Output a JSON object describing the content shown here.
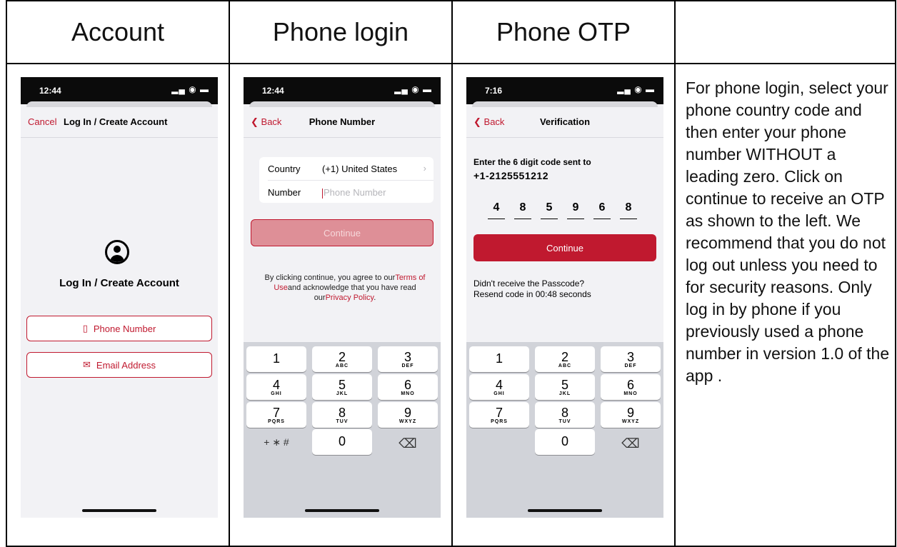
{
  "headers": [
    "Account",
    "Phone login",
    "Phone OTP",
    ""
  ],
  "phone_account": {
    "time": "12:44",
    "status_icons": "▂▄ ◉ ▬",
    "nav_left": "Cancel",
    "nav_title": "Log In / Create Account",
    "heading": "Log In / Create Account",
    "phone_button": "Phone Number",
    "email_button": "Email Address",
    "phone_glyph": "▯",
    "email_glyph": "✉"
  },
  "phone_login": {
    "time": "12:44",
    "status_icons": "▂▄ ◉ ▬",
    "back_glyph": "❮",
    "nav_left": "Back",
    "nav_title": "Phone Number",
    "country_label": "Country",
    "country_value": "(+1) United States",
    "chevron": "›",
    "number_label": "Number",
    "number_placeholder": "Phone Number",
    "continue_label": "Continue",
    "legal_pre": "By clicking continue, you agree to our",
    "legal_terms": "Terms of Use",
    "legal_mid": "and acknowledge that you have read our",
    "legal_privacy": "Privacy Policy",
    "legal_end": "."
  },
  "phone_otp": {
    "time": "7:16",
    "status_icons": "▂▄ ◉ ▬",
    "back_glyph": "❮",
    "nav_left": "Back",
    "nav_title": "Verification",
    "prompt": "Enter the 6 digit code sent to",
    "number": "+1-2125551212",
    "digits": [
      "4",
      "8",
      "5",
      "9",
      "6",
      "8"
    ],
    "continue_label": "Continue",
    "resend_line1": "Didn't receive the Passcode?",
    "resend_line2": "Resend code in 00:48 seconds"
  },
  "keypad": {
    "keys": [
      {
        "d": "1",
        "l": ""
      },
      {
        "d": "2",
        "l": "ABC"
      },
      {
        "d": "3",
        "l": "DEF"
      },
      {
        "d": "4",
        "l": "GHI"
      },
      {
        "d": "5",
        "l": "JKL"
      },
      {
        "d": "6",
        "l": "MNO"
      },
      {
        "d": "7",
        "l": "PQRS"
      },
      {
        "d": "8",
        "l": "TUV"
      },
      {
        "d": "9",
        "l": "WXYZ"
      }
    ],
    "symbols": "+ ∗ #",
    "zero": "0",
    "delete_glyph": "⌫"
  },
  "description": "For phone login, select your phone country code and then enter your phone number WITHOUT a leading zero. Click on continue to  receive an OTP as shown to the left. We recommend that you do not log out unless you need to for security reasons. Only log in by phone if you previously used a phone number in version 1.0 of the app ."
}
